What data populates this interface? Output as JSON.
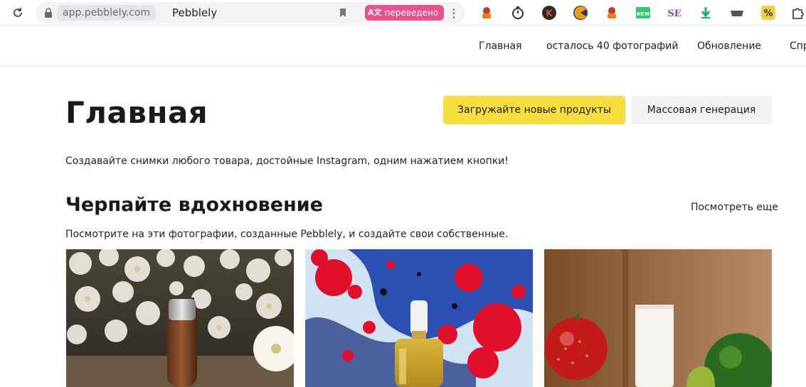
{
  "browser": {
    "url": "app.pebblely.com",
    "tab_title": "Pebblely",
    "translated_label": "переведено",
    "extensions": [
      "puzzle-person-icon",
      "timer-icon",
      "k-icon",
      "pacman-icon",
      "puzzle-person-icon",
      "new-icon",
      "se-icon",
      "download-arrow-icon",
      "tray-icon",
      "percent-icon",
      "puzzle-icon"
    ]
  },
  "nav": {
    "home": "Главная",
    "remaining": "осталось 40 фотографий",
    "upgrade": "Обновление",
    "help": "Спр"
  },
  "main": {
    "title": "Главная",
    "upload_button": "Загружайте новые продукты",
    "bulk_button": "Массовая генерация",
    "subtitle": "Создавайте снимки любого товара, достойные Instagram, одним нажатием кнопки!"
  },
  "inspiration": {
    "title": "Черпайте вдохновение",
    "see_more": "Посмотреть еще",
    "description": "Посмотрите на эти фотографии, созданные Pebblely, и создайте свои собственные."
  },
  "colors": {
    "accent": "#f8dd3e",
    "secondary_button": "#f2f2f2",
    "translate_badge": "#e8518d"
  }
}
